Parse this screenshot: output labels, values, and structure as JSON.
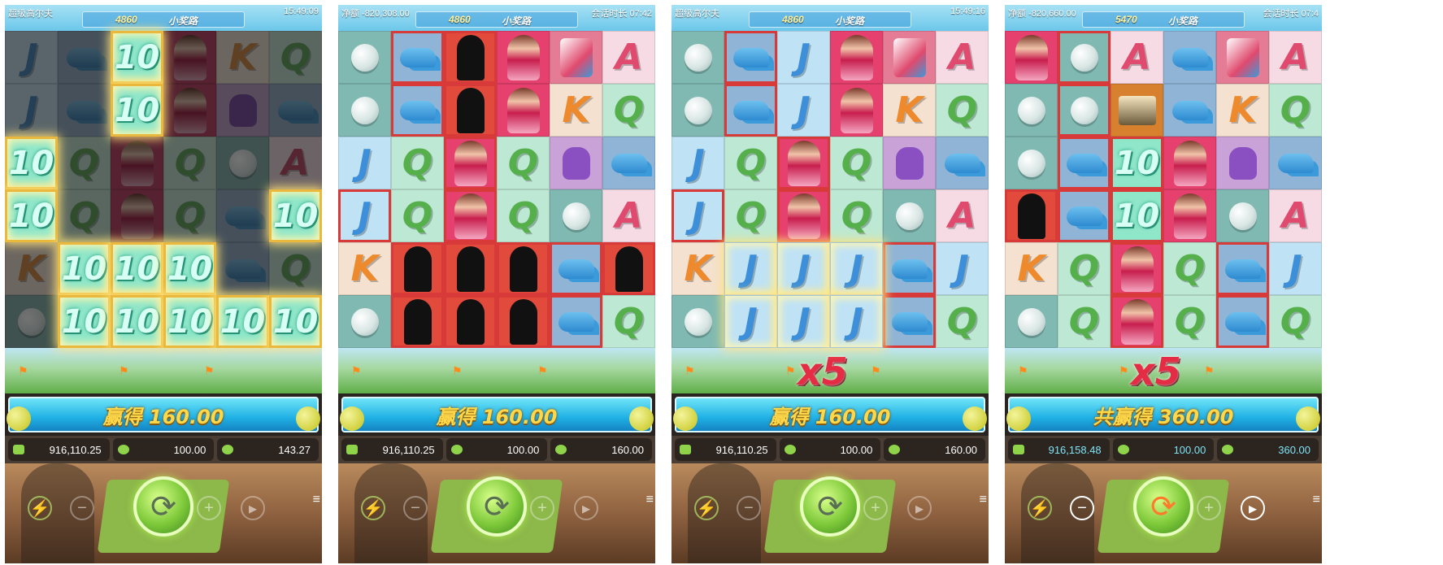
{
  "symbols": {
    "J": {
      "kind": "letter",
      "text": "J"
    },
    "Q": {
      "kind": "letter",
      "text": "Q"
    },
    "K": {
      "kind": "letter",
      "text": "K"
    },
    "A": {
      "kind": "letter",
      "text": "A"
    },
    "ten": {
      "kind": "letter",
      "text": "10"
    },
    "ball": {
      "kind": "icon",
      "icon": "golf-ball-icon"
    },
    "cap": {
      "kind": "icon",
      "icon": "visor-cap-icon"
    },
    "girl": {
      "kind": "icon",
      "icon": "golfer-girl-icon"
    },
    "sil": {
      "kind": "icon",
      "icon": "golfer-silhouette-icon"
    },
    "bag": {
      "kind": "icon",
      "icon": "golf-bag-icon"
    },
    "glove": {
      "kind": "icon",
      "icon": "golf-glove-icon"
    },
    "cart": {
      "kind": "icon",
      "icon": "golf-cart-icon"
    },
    "sparkle": {
      "kind": "icon",
      "icon": "sparkle-icon"
    }
  },
  "panels": [
    {
      "top_left": "超级高尔夫",
      "top_right": "15:49:09",
      "score": "4860",
      "pill_text": "小奖路",
      "multiplier": "",
      "win_text": "赢得 160.00",
      "balance": "916,110.25",
      "bet": "100.00",
      "win": "143.27",
      "stats_cyan": false,
      "spin_orange": false,
      "grid": [
        [
          "J",
          "cap",
          "ten",
          "girl",
          "K",
          "Q"
        ],
        [
          "J",
          "cap",
          "ten",
          "girl",
          "glove",
          "cap"
        ],
        [
          "ten",
          "Q",
          "girl",
          "Q",
          "ball",
          "A"
        ],
        [
          "ten",
          "Q",
          "girl",
          "Q",
          "cap",
          "ten"
        ],
        [
          "K",
          "ten",
          "ten",
          "ten",
          "cap",
          "Q"
        ],
        [
          "ball",
          "ten",
          "ten",
          "ten",
          "ten",
          "ten"
        ]
      ],
      "states": [
        [
          "d",
          "d",
          "g",
          "d",
          "d",
          "d"
        ],
        [
          "d",
          "d",
          "g",
          "d",
          "d",
          "d"
        ],
        [
          "g",
          "d",
          "d",
          "d",
          "d",
          "d"
        ],
        [
          "g",
          "d",
          "d",
          "d",
          "d",
          "g"
        ],
        [
          "d",
          "g",
          "g",
          "g",
          "d",
          "d"
        ],
        [
          "d",
          "g",
          "g",
          "g",
          "g",
          "g"
        ]
      ]
    },
    {
      "top_left": "净额 -820,308.00",
      "top_right": "会话时长 07:42",
      "score": "4860",
      "pill_text": "小奖路",
      "multiplier": "",
      "win_text": "赢得 160.00",
      "balance": "916,110.25",
      "bet": "100.00",
      "win": "160.00",
      "stats_cyan": false,
      "spin_orange": false,
      "grid": [
        [
          "ball",
          "cap",
          "sil",
          "girl",
          "bag",
          "A"
        ],
        [
          "ball",
          "cap",
          "sil",
          "girl",
          "K",
          "Q"
        ],
        [
          "J",
          "Q",
          "girl",
          "Q",
          "glove",
          "cap"
        ],
        [
          "J",
          "Q",
          "girl",
          "Q",
          "ball",
          "A"
        ],
        [
          "K",
          "sil",
          "sil",
          "sil",
          "cap",
          "sil"
        ],
        [
          "ball",
          "sil",
          "sil",
          "sil",
          "cap",
          "Q"
        ]
      ],
      "states": [
        [
          "n",
          "f",
          "f",
          "n",
          "n",
          "n"
        ],
        [
          "n",
          "f",
          "f",
          "n",
          "n",
          "n"
        ],
        [
          "n",
          "n",
          "f",
          "n",
          "n",
          "n"
        ],
        [
          "f",
          "n",
          "f",
          "n",
          "n",
          "n"
        ],
        [
          "n",
          "f",
          "f",
          "f",
          "f",
          "f"
        ],
        [
          "n",
          "f",
          "f",
          "f",
          "f",
          "n"
        ]
      ]
    },
    {
      "top_left": "超级高尔夫",
      "top_right": "15:49:16",
      "score": "4860",
      "pill_text": "小奖路",
      "multiplier": "x5",
      "win_text": "赢得 160.00",
      "balance": "916,110.25",
      "bet": "100.00",
      "win": "160.00",
      "stats_cyan": false,
      "spin_orange": false,
      "grid": [
        [
          "ball",
          "cap",
          "J",
          "girl",
          "bag",
          "A"
        ],
        [
          "ball",
          "cap",
          "J",
          "girl",
          "K",
          "Q"
        ],
        [
          "J",
          "Q",
          "girl",
          "Q",
          "glove",
          "cap"
        ],
        [
          "J",
          "Q",
          "girl",
          "Q",
          "ball",
          "A"
        ],
        [
          "K",
          "J",
          "J",
          "J",
          "cap",
          "J"
        ],
        [
          "ball",
          "J",
          "J",
          "J",
          "cap",
          "Q"
        ]
      ],
      "states": [
        [
          "n",
          "f",
          "n",
          "n",
          "n",
          "n"
        ],
        [
          "n",
          "f",
          "n",
          "n",
          "n",
          "n"
        ],
        [
          "n",
          "n",
          "f",
          "n",
          "n",
          "n"
        ],
        [
          "f",
          "n",
          "f",
          "n",
          "n",
          "n"
        ],
        [
          "n",
          "s",
          "s",
          "s",
          "f",
          "n"
        ],
        [
          "n",
          "s",
          "s",
          "s",
          "f",
          "n"
        ]
      ]
    },
    {
      "top_left": "净额 -820,660.00",
      "top_right": "会话时长 07:4",
      "score": "5470",
      "pill_text": "小奖路",
      "multiplier": "x5",
      "win_text": "共赢得 360.00",
      "balance": "916,158.48",
      "bet": "100.00",
      "win": "360.00",
      "stats_cyan": true,
      "spin_orange": true,
      "grid": [
        [
          "girl",
          "ball",
          "A",
          "cap",
          "bag",
          "A"
        ],
        [
          "ball",
          "ball",
          "cart",
          "cap",
          "K",
          "Q"
        ],
        [
          "ball",
          "cap",
          "ten",
          "girl",
          "glove",
          "cap"
        ],
        [
          "sil",
          "cap",
          "ten",
          "girl",
          "ball",
          "A"
        ],
        [
          "K",
          "Q",
          "girl",
          "Q",
          "cap",
          "J"
        ],
        [
          "ball",
          "Q",
          "girl",
          "Q",
          "cap",
          "Q"
        ]
      ],
      "states": [
        [
          "n",
          "f",
          "n",
          "n",
          "n",
          "n"
        ],
        [
          "n",
          "f",
          "n",
          "n",
          "n",
          "n"
        ],
        [
          "n",
          "f",
          "f",
          "n",
          "n",
          "n"
        ],
        [
          "f",
          "f",
          "f",
          "n",
          "n",
          "n"
        ],
        [
          "n",
          "n",
          "f",
          "n",
          "f",
          "n"
        ],
        [
          "n",
          "n",
          "f",
          "n",
          "f",
          "n"
        ]
      ]
    }
  ]
}
